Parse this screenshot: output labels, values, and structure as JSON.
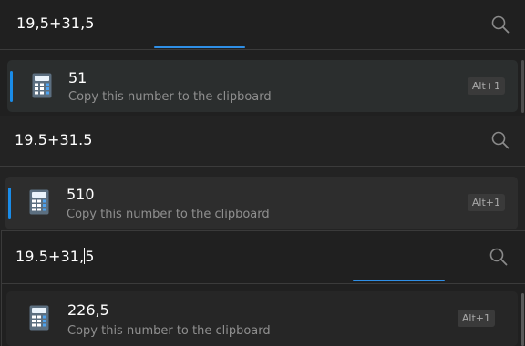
{
  "panels": [
    {
      "query": "19,5+31,5",
      "result": {
        "value": "51",
        "subtitle": "Copy this number to the clipboard",
        "shortcut": "Alt+1"
      }
    },
    {
      "query": "19.5+31.5",
      "result": {
        "value": "510",
        "subtitle": "Copy this number to the clipboard",
        "shortcut": "Alt+1"
      }
    },
    {
      "query_before_caret": "19.5+31,",
      "query_after_caret": "5",
      "result": {
        "value": "226,5",
        "subtitle": "Copy this number to the clipboard",
        "shortcut": "Alt+1"
      }
    }
  ],
  "icons": {
    "search": "search-icon",
    "calculator": "calculator-icon"
  },
  "colors": {
    "accent": "#2f8fe6",
    "background": "#202020",
    "result_bg": "#2d2d2d",
    "text_primary": "#ffffff",
    "text_secondary": "#8f8f8f"
  }
}
